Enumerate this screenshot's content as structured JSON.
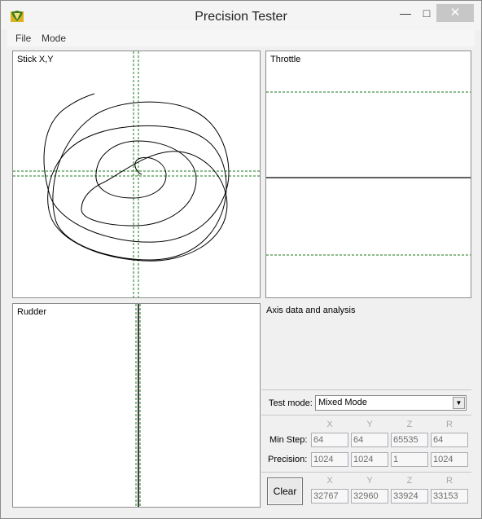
{
  "window": {
    "title": "Precision Tester",
    "minimize_glyph": "—",
    "maximize_glyph": "□",
    "close_glyph": "✕"
  },
  "menu": {
    "file": "File",
    "mode": "Mode"
  },
  "panels": {
    "stick": "Stick X,Y",
    "throttle": "Throttle",
    "rudder": "Rudder",
    "analysis": "Axis data and analysis"
  },
  "test_mode": {
    "label": "Test mode:",
    "value": "Mixed Mode"
  },
  "axes_headers": [
    "X",
    "Y",
    "Z",
    "R"
  ],
  "min_step": {
    "label": "Min Step:",
    "values": [
      "64",
      "64",
      "65535",
      "64"
    ]
  },
  "precision": {
    "label": "Precision:",
    "values": [
      "1024",
      "1024",
      "1",
      "1024"
    ]
  },
  "current": {
    "values": [
      "32767",
      "32960",
      "33924",
      "33153"
    ]
  },
  "clear_label": "Clear",
  "colors": {
    "guide": "#1a7a1a",
    "trace": "#000000",
    "close_btn": "#c7c7c7"
  }
}
